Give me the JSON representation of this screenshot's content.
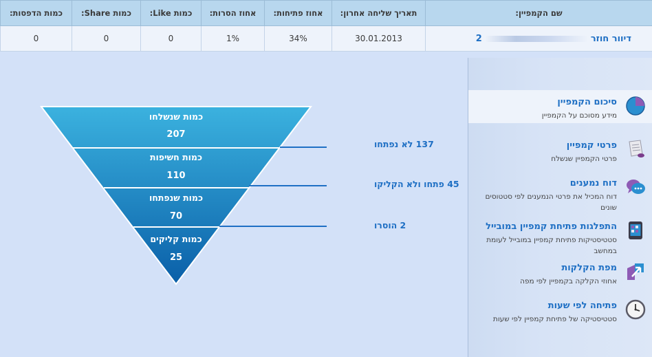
{
  "table": {
    "headers": {
      "campaign_name": "שם הקמפיין:",
      "last_sent": "תאריך שליחה אחרון:",
      "open_pct": "אחוז פתיחות:",
      "removed_pct": "אחוז הסרות:",
      "like_count": "כמות Like:",
      "share_count": "כמות Share:",
      "print_count": "כמות הדפסות:"
    },
    "row": {
      "campaign_name_prefix": "דיוור חוזר",
      "campaign_name_suffix": "2",
      "last_sent": "30.01.2013",
      "open_pct": "34%",
      "removed_pct": "1%",
      "like_count": "0",
      "share_count": "0",
      "print_count": "0"
    }
  },
  "sidebar": {
    "items": [
      {
        "title": "סיכום הקמפיין",
        "desc": "מידע מסוכם על הקמפיין",
        "icon": "pie-chart-icon"
      },
      {
        "title": "פרטי קמפיין",
        "desc": "פרטי הקמפיין שנשלח",
        "icon": "document-icon"
      },
      {
        "title": "דוח נמענים",
        "desc": "דוח המכיל את פרטי הנמענים לפי סטטוסים שונים",
        "icon": "chat-bubbles-icon"
      },
      {
        "title": "התפלגות פתיחת קמפיין במובייל",
        "desc": "סטטיסטיקות פתיחת קמפיין במובייל לעומת במחשב",
        "icon": "mobile-icon"
      },
      {
        "title": "מפת הקלקות",
        "desc": "אחוזי הקלקה בקמפיין לפי מפה",
        "icon": "click-map-icon"
      },
      {
        "title": "פתיחה לפי שעות",
        "desc": "סטטיסטיקה של פתיחת קמפיין לפי שעות",
        "icon": "clock-icon"
      }
    ]
  },
  "funnel": {
    "levels": [
      {
        "label": "כמות שנשלחו",
        "value": "207"
      },
      {
        "label": "כמות חשיפות",
        "value": "110"
      },
      {
        "label": "כמות שנפתחו",
        "value": "70"
      },
      {
        "label": "כמות קליקים",
        "value": "25"
      }
    ],
    "callouts": [
      "137 לא נפתחו",
      "45 פתחו ולא הקליקו",
      "2 הוסרו"
    ]
  },
  "colors": {
    "accent": "#1e6fc4",
    "header_bg": "#b8d7ee",
    "page_bg": "#d3e1f8"
  }
}
